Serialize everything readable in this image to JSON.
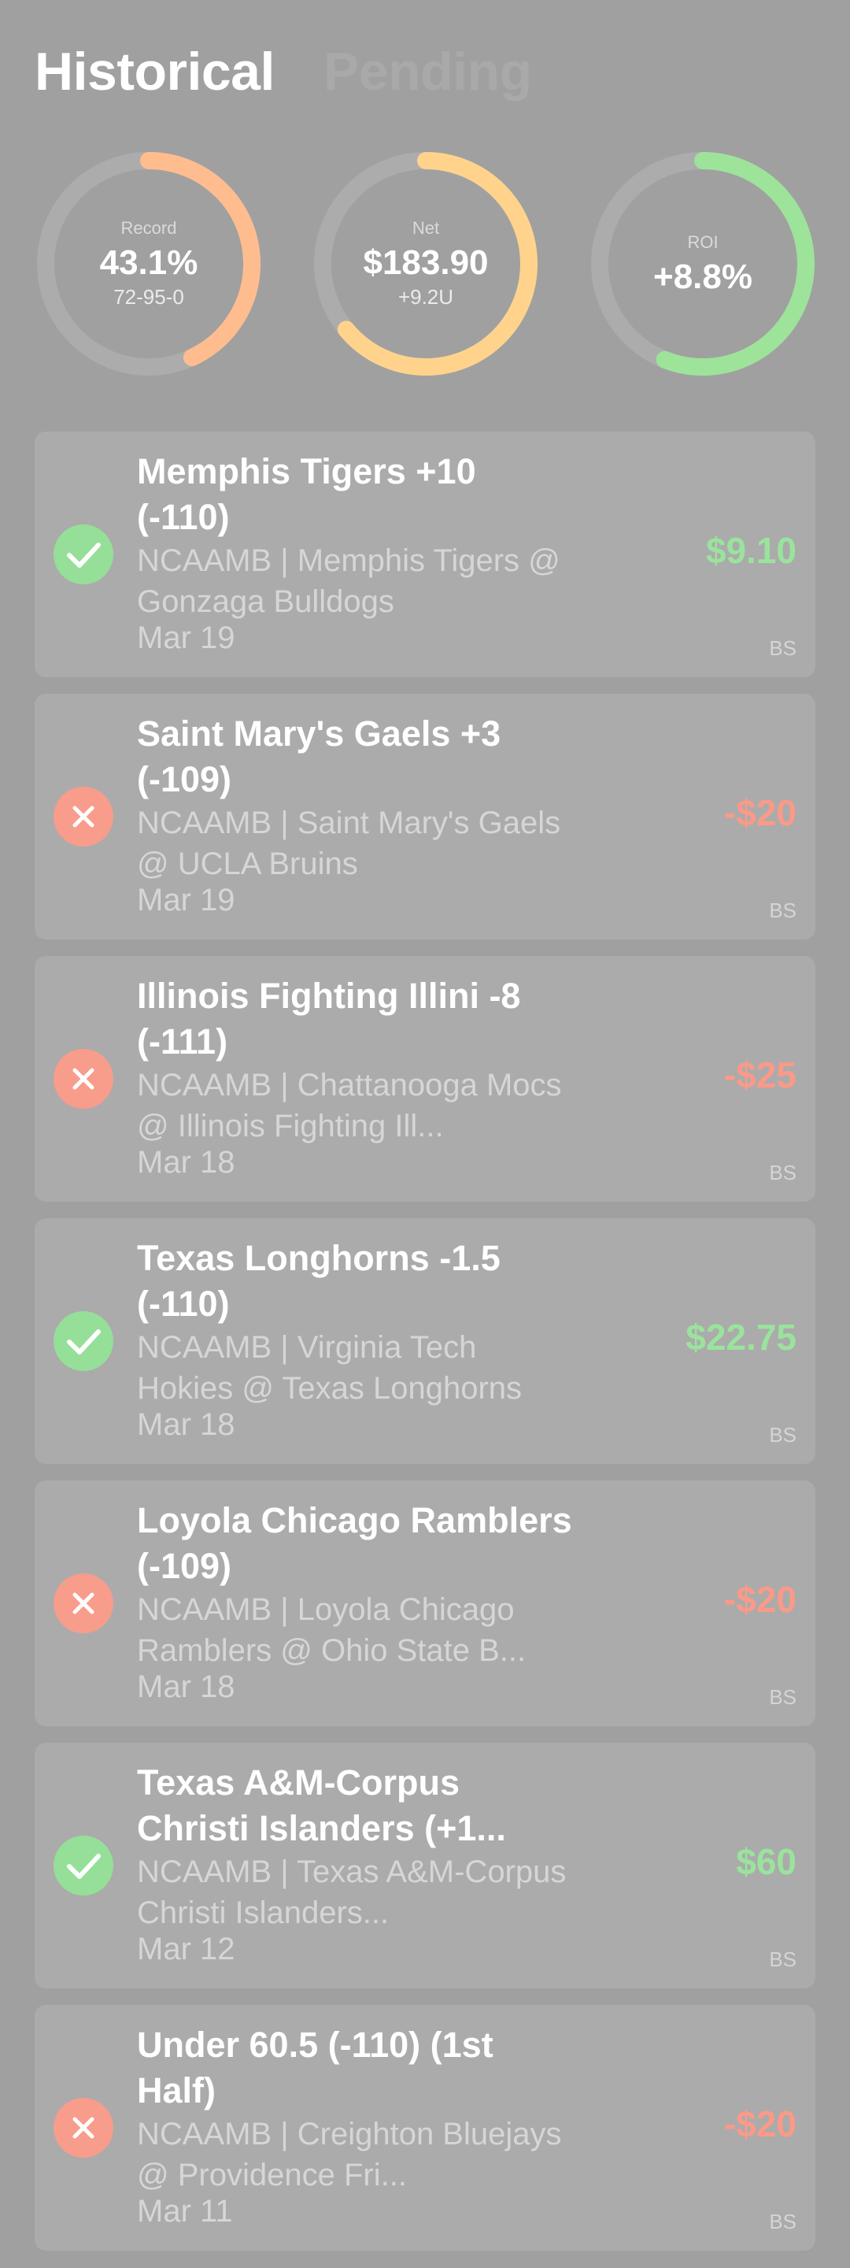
{
  "tabs": {
    "historical": "Historical",
    "pending": "Pending"
  },
  "stats": {
    "record": {
      "label": "Record",
      "value": "43.1%",
      "sub": "72-95-0",
      "color": "#ffbd8f",
      "fraction": 0.431
    },
    "net": {
      "label": "Net",
      "value": "$183.90",
      "sub": "+9.2U",
      "color": "#ffd38c",
      "fraction": 0.64
    },
    "roi": {
      "label": "ROI",
      "value": "+8.8%",
      "color": "#9de39a",
      "fraction": 0.56
    }
  },
  "colors": {
    "win": "#95df98",
    "loss": "#f89c8c",
    "ring_track": "#acacac"
  },
  "bets": [
    {
      "result": "win",
      "icon": "checkmark-icon",
      "title": "Memphis Tigers +10 (-110)",
      "description": "NCAAMB | Memphis Tigers @ Gonzaga Bulldogs",
      "date": "Mar 19",
      "amount": "$9.10",
      "book": "BS"
    },
    {
      "result": "loss",
      "icon": "x-icon",
      "title": "Saint Mary's Gaels +3 (-109)",
      "description": "NCAAMB | Saint Mary's Gaels @ UCLA Bruins",
      "date": "Mar 19",
      "amount": "-$20",
      "book": "BS"
    },
    {
      "result": "loss",
      "icon": "x-icon",
      "title": "Illinois Fighting Illini -8 (-111)",
      "description": "NCAAMB | Chattanooga Mocs @ Illinois Fighting Ill...",
      "date": "Mar 18",
      "amount": "-$25",
      "book": "BS"
    },
    {
      "result": "win",
      "icon": "checkmark-icon",
      "title": "Texas Longhorns -1.5 (-110)",
      "description": "NCAAMB | Virginia Tech Hokies @ Texas Longhorns",
      "date": "Mar 18",
      "amount": "$22.75",
      "book": "BS"
    },
    {
      "result": "loss",
      "icon": "x-icon",
      "title": "Loyola Chicago Ramblers (-109)",
      "description": "NCAAMB | Loyola Chicago Ramblers @ Ohio State B...",
      "date": "Mar 18",
      "amount": "-$20",
      "book": "BS"
    },
    {
      "result": "win",
      "icon": "checkmark-icon",
      "title": "Texas A&M-Corpus Christi Islanders (+1...",
      "description": "NCAAMB | Texas A&M-Corpus Christi Islanders...",
      "date": "Mar 12",
      "amount": "$60",
      "book": "BS"
    },
    {
      "result": "loss",
      "icon": "x-icon",
      "title": "Under 60.5 (-110) (1st Half)",
      "description": "NCAAMB | Creighton Bluejays @ Providence Fri...",
      "date": "Mar 11",
      "amount": "-$20",
      "book": "BS"
    }
  ]
}
